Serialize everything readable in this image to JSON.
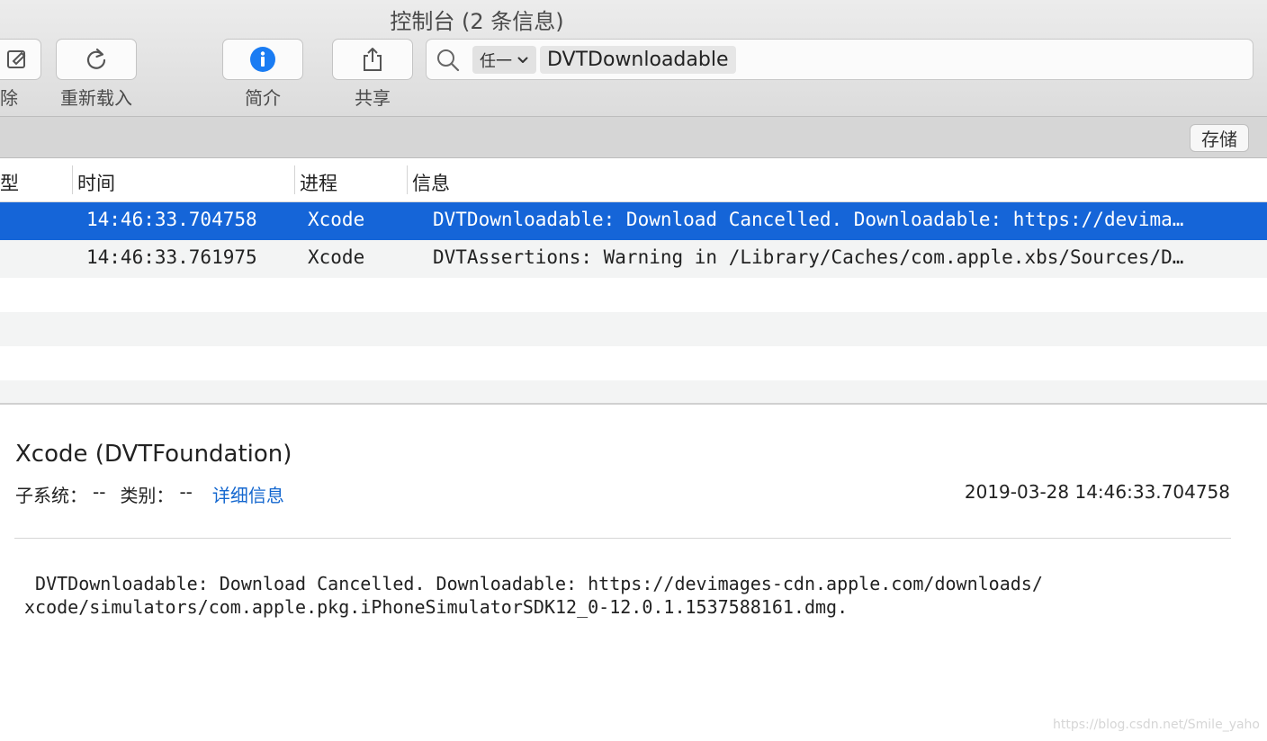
{
  "window": {
    "title": "控制台 (2 条信息)"
  },
  "toolbar": {
    "clear_label": "除",
    "reload_label": "重新载入",
    "info_label": "简介",
    "share_label": "共享",
    "search": {
      "scope": "任一",
      "token": "DVTDownloadable"
    }
  },
  "subbar": {
    "save_label": "存储"
  },
  "table": {
    "headers": {
      "type": "型",
      "time": "时间",
      "process": "进程",
      "message": "信息"
    },
    "rows": [
      {
        "time": "14:46:33.704758",
        "process": "Xcode",
        "message": "DVTDownloadable: Download Cancelled. Downloadable: https://devima…"
      },
      {
        "time": "14:46:33.761975",
        "process": "Xcode",
        "message": "DVTAssertions: Warning in /Library/Caches/com.apple.xbs/Sources/D…"
      }
    ]
  },
  "detail": {
    "title": "Xcode (DVTFoundation)",
    "subsystem_label": "子系统：",
    "subsystem_value": "--",
    "category_label": "类别：",
    "category_value": "--",
    "details_link": "详细信息",
    "timestamp": "2019-03-28 14:46:33.704758",
    "body": " DVTDownloadable: Download Cancelled. Downloadable: https://devimages-cdn.apple.com/downloads/\nxcode/simulators/com.apple.pkg.iPhoneSimulatorSDK12_0-12.0.1.1537588161.dmg."
  },
  "watermark": "https://blog.csdn.net/Smile_yaho",
  "colors": {
    "selection": "#1565d8",
    "link": "#1467cf",
    "info_icon": "#1a7cf3"
  }
}
